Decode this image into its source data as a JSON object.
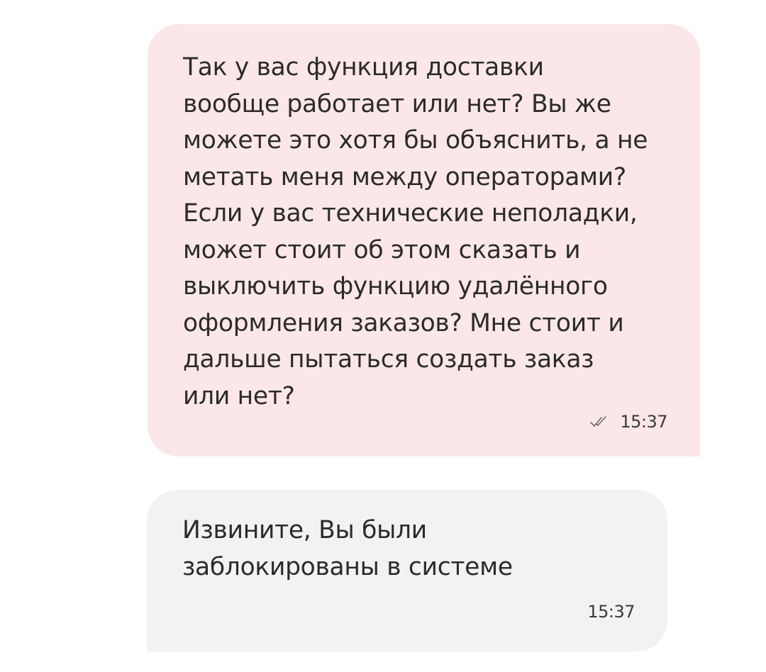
{
  "messages": [
    {
      "direction": "outgoing",
      "text": "Так у вас функция доставки\nвообще работает или нет? Вы же\nможете это хотя бы объяснить, а не\nметать меня между операторами?\nЕсли у вас технические неполадки,\nможет стоит об этом сказать и\nвыключить функцию удалённого\nоформления заказов? Мне стоит и\nдальше пытаться создать заказ\nили нет?",
      "time": "15:37",
      "status_icon": "double-check-icon"
    },
    {
      "direction": "incoming",
      "text": "Извините, Вы были\nзаблокированы в системе",
      "time": "15:37"
    }
  ],
  "colors": {
    "outgoing_bubble": "#fbe7e8",
    "incoming_bubble": "#f2f2f2",
    "text": "#2b2b2b"
  }
}
